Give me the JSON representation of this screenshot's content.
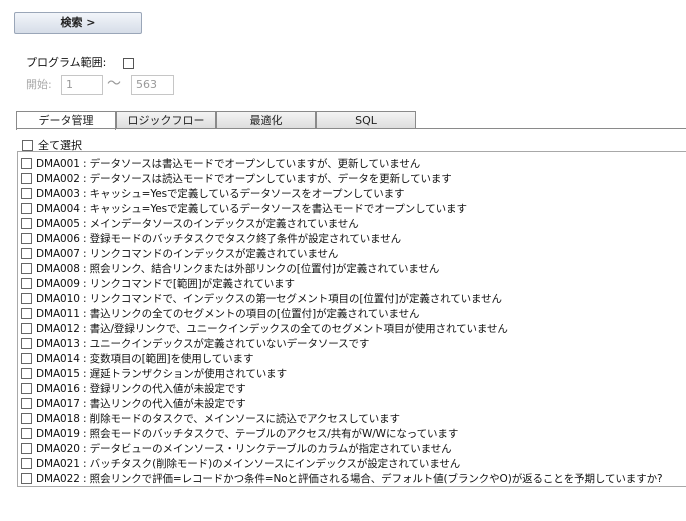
{
  "search": {
    "label": "検索 >"
  },
  "range": {
    "label": "プログラム範囲:",
    "start_label": "開始:",
    "start_value": "1",
    "tilde": "〜",
    "end_value": "563"
  },
  "tabs": [
    {
      "label": "データ管理",
      "active": true
    },
    {
      "label": "ロジックフロー",
      "active": false
    },
    {
      "label": "最適化",
      "active": false
    },
    {
      "label": "SQL",
      "active": false
    }
  ],
  "select_all": {
    "label": "全て選択"
  },
  "items": [
    {
      "label": "DMA001 : データソースは書込モードでオープンしていますが、更新していません"
    },
    {
      "label": "DMA002 : データソースは読込モードでオープンしていますが、データを更新しています"
    },
    {
      "label": "DMA003 : キャッシュ=Yesで定義しているデータソースをオープンしています"
    },
    {
      "label": "DMA004 : キャッシュ=Yesで定義しているデータソースを書込モードでオープンしています"
    },
    {
      "label": "DMA005 : メインデータソースのインデックスが定義されていません"
    },
    {
      "label": "DMA006 : 登録モードのバッチタスクでタスク終了条件が設定されていません"
    },
    {
      "label": "DMA007 : リンクコマンドのインデックスが定義されていません"
    },
    {
      "label": "DMA008 : 照会リンク、結合リンクまたは外部リンクの[位置付]が定義されていません"
    },
    {
      "label": "DMA009 : リンクコマンドで[範囲]が定義されています"
    },
    {
      "label": "DMA010 : リンクコマンドで、インデックスの第一セグメント項目の[位置付]が定義されていません"
    },
    {
      "label": "DMA011 : 書込リンクの全てのセグメントの項目の[位置付]が定義されていません"
    },
    {
      "label": "DMA012 : 書込/登録リンクで、ユニークインデックスの全てのセグメント項目が使用されていません"
    },
    {
      "label": "DMA013 : ユニークインデックスが定義されていないデータソースです"
    },
    {
      "label": "DMA014 : 変数項目の[範囲]を使用しています"
    },
    {
      "label": "DMA015 : 遅延トランザクションが使用されています"
    },
    {
      "label": "DMA016 : 登録リンクの代入値が未設定です"
    },
    {
      "label": "DMA017 : 書込リンクの代入値が未設定です"
    },
    {
      "label": "DMA018 : 削除モードのタスクで、メインソースに読込でアクセスしています"
    },
    {
      "label": "DMA019 : 照会モードのバッチタスクで、テーブルのアクセス/共有がW/Wになっています"
    },
    {
      "label": "DMA020 : データビューのメインソース・リンクテーブルのカラムが指定されていません"
    },
    {
      "label": "DMA021 : バッチタスク(削除モード)のメインソースにインデックスが設定されていません"
    },
    {
      "label": "DMA022 : 照会リンクで評価=レコードかつ条件=Noと評価される場合、デフォルト値(ブランクやO)が返ることを予期していますか?"
    }
  ]
}
